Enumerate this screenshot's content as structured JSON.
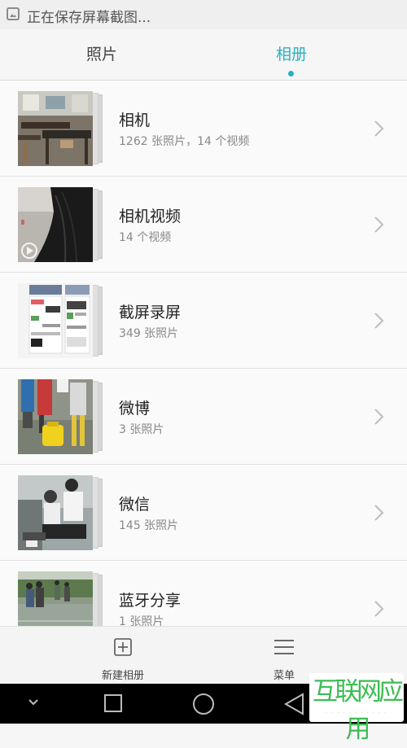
{
  "status_bar": {
    "text": "正在保存屏幕截图..."
  },
  "tabs": [
    {
      "label": "照片",
      "active": false
    },
    {
      "label": "相册",
      "active": true
    }
  ],
  "accent_color": "#27b1c4",
  "albums": [
    {
      "name": "相机",
      "count": "1262 张照片，14 个视频"
    },
    {
      "name": "相机视频",
      "count": "14 个视频"
    },
    {
      "name": "截屏录屏",
      "count": "349 张照片"
    },
    {
      "name": "微博",
      "count": "3 张照片"
    },
    {
      "name": "微信",
      "count": "145 张照片"
    },
    {
      "name": "蓝牙分享",
      "count": "1 张照片"
    }
  ],
  "bottom_bar": {
    "new_album_label": "新建相册",
    "menu_label": "菜单"
  },
  "nav_icons": [
    "chevron-down-icon",
    "square-icon",
    "circle-icon",
    "back-triangle-icon"
  ],
  "watermark": {
    "text": "互联网应用"
  }
}
